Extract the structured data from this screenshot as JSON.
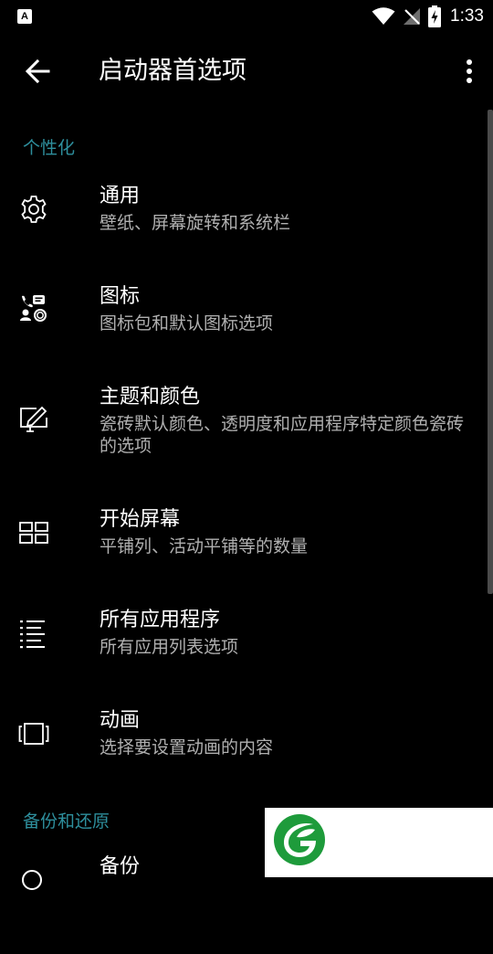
{
  "status": {
    "time": "1:33",
    "app_badge": "A"
  },
  "appbar": {
    "title": "启动器首选项"
  },
  "sections": [
    {
      "label": "个性化"
    },
    {
      "label": "备份和还原"
    }
  ],
  "items": [
    {
      "title": "通用",
      "subtitle": "壁纸、屏幕旋转和系统栏",
      "icon": "gear-icon"
    },
    {
      "title": "图标",
      "subtitle": "图标包和默认图标选项",
      "icon": "icon-pack-icon"
    },
    {
      "title": "主题和颜色",
      "subtitle": "瓷砖默认颜色、透明度和应用程序特定颜色瓷砖的选项",
      "icon": "theme-edit-icon"
    },
    {
      "title": "开始屏幕",
      "subtitle": "平铺列、活动平铺等的数量",
      "icon": "tiles-icon"
    },
    {
      "title": "所有应用程序",
      "subtitle": "所有应用列表选项",
      "icon": "list-icon"
    },
    {
      "title": "动画",
      "subtitle": "选择要设置动画的内容",
      "icon": "carousel-icon"
    },
    {
      "title": "备份",
      "subtitle": "",
      "icon": "search-icon"
    }
  ]
}
